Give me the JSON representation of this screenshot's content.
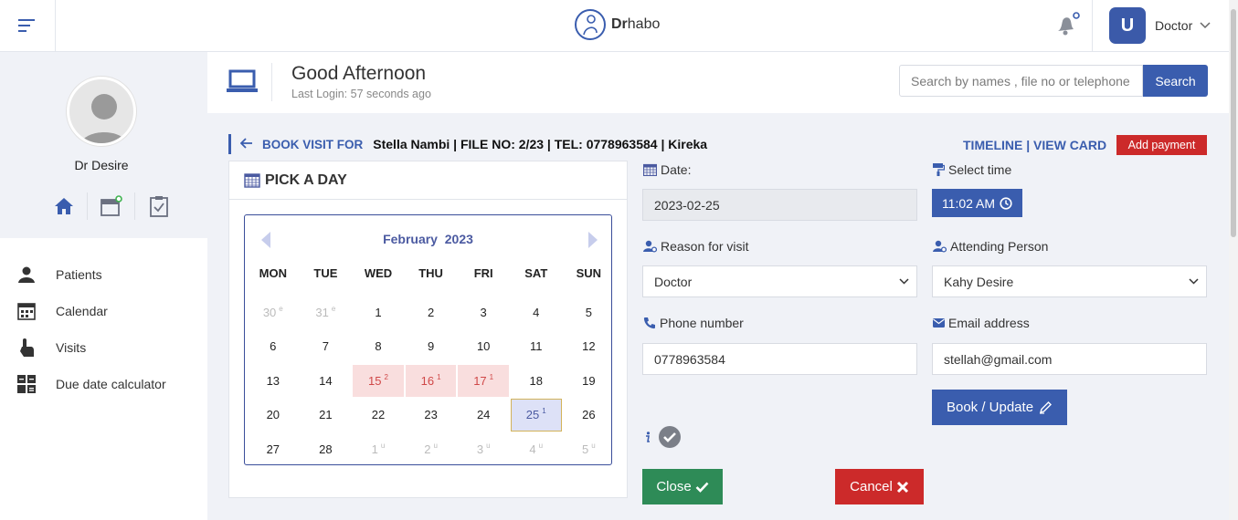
{
  "app": {
    "brand_bold": "Dr",
    "brand_rest": "habo"
  },
  "topbar": {
    "user_initial": "U",
    "user_role": "Doctor"
  },
  "sidebar": {
    "profile_name": "Dr Desire",
    "items": [
      {
        "label": "Patients",
        "icon": "person-icon"
      },
      {
        "label": "Calendar",
        "icon": "calendar-icon"
      },
      {
        "label": "Visits",
        "icon": "hand-pointer-icon"
      },
      {
        "label": "Due date calculator",
        "icon": "calculator-icon"
      }
    ]
  },
  "header": {
    "greeting": "Good Afternoon",
    "last_login": "Last Login: 57 seconds ago",
    "search_placeholder": "Search by names , file no or telephone",
    "search_button": "Search"
  },
  "booking": {
    "label": "BOOK VISIT FOR",
    "patient_info": "Stella Nambi | FILE NO: 2/23 | TEL: 0778963584 | Kireka",
    "links": "TIMELINE | VIEW CARD",
    "add_payment": "Add payment"
  },
  "calendar": {
    "panel_title": "PICK A DAY",
    "month": "February",
    "year": "2023",
    "weekdays": [
      "MON",
      "TUE",
      "WED",
      "THU",
      "FRI",
      "SAT",
      "SUN"
    ],
    "rows": [
      [
        {
          "d": "30",
          "s": "e",
          "k": "muted"
        },
        {
          "d": "31",
          "s": "e",
          "k": "muted"
        },
        {
          "d": "1"
        },
        {
          "d": "2"
        },
        {
          "d": "3"
        },
        {
          "d": "4"
        },
        {
          "d": "5"
        }
      ],
      [
        {
          "d": "6"
        },
        {
          "d": "7"
        },
        {
          "d": "8"
        },
        {
          "d": "9"
        },
        {
          "d": "10"
        },
        {
          "d": "11"
        },
        {
          "d": "12"
        }
      ],
      [
        {
          "d": "13"
        },
        {
          "d": "14"
        },
        {
          "d": "15",
          "s": "2",
          "k": "busy"
        },
        {
          "d": "16",
          "s": "1",
          "k": "busy"
        },
        {
          "d": "17",
          "s": "1",
          "k": "busy"
        },
        {
          "d": "18"
        },
        {
          "d": "19"
        }
      ],
      [
        {
          "d": "20"
        },
        {
          "d": "21"
        },
        {
          "d": "22"
        },
        {
          "d": "23"
        },
        {
          "d": "24"
        },
        {
          "d": "25",
          "s": "1",
          "k": "selected"
        },
        {
          "d": "26"
        }
      ],
      [
        {
          "d": "27"
        },
        {
          "d": "28"
        },
        {
          "d": "1",
          "s": "u",
          "k": "muted"
        },
        {
          "d": "2",
          "s": "u",
          "k": "muted"
        },
        {
          "d": "3",
          "s": "u",
          "k": "muted"
        },
        {
          "d": "4",
          "s": "u",
          "k": "muted"
        },
        {
          "d": "5",
          "s": "u",
          "k": "muted"
        }
      ]
    ]
  },
  "form": {
    "date_label": "Date:",
    "date_value": "2023-02-25",
    "time_label": "Select time",
    "time_value": "11:02 AM",
    "reason_label": "Reason for visit",
    "reason_value": "Doctor",
    "attending_label": "Attending Person",
    "attending_value": "Kahy Desire",
    "phone_label": "Phone number",
    "phone_value": "0778963584",
    "email_label": "Email address",
    "email_value": "stellah@gmail.com",
    "book_button": "Book / Update",
    "close_button": "Close",
    "cancel_button": "Cancel"
  },
  "colors": {
    "primary": "#3a5dae",
    "danger": "#cc2a2a",
    "success": "#2e8b57"
  }
}
